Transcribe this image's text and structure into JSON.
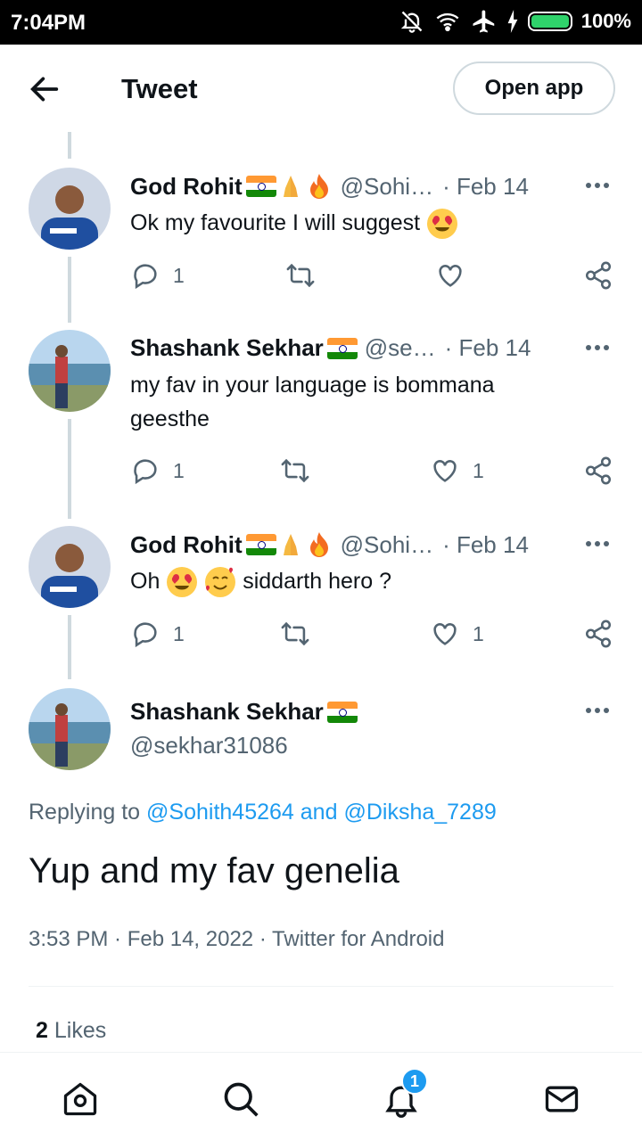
{
  "status_bar": {
    "time": "7:04PM",
    "battery": "100%"
  },
  "header": {
    "title": "Tweet",
    "open_app": "Open app"
  },
  "thread": [
    {
      "name": "God Rohit",
      "handle": "@Sohi…",
      "date": "· Feb 14",
      "text": "Ok my favourite I will suggest",
      "replies": "1",
      "retweets": "",
      "likes": ""
    },
    {
      "name": "Shashank Sekhar",
      "handle": "@se…",
      "date": "· Feb 14",
      "text": "my fav in your language is bommana geesthe",
      "replies": "1",
      "retweets": "",
      "likes": "1"
    },
    {
      "name": "God Rohit",
      "handle": "@Sohi…",
      "date": "· Feb 14",
      "text_before": "Oh",
      "text_after": "siddarth hero ?",
      "replies": "1",
      "retweets": "",
      "likes": "1"
    }
  ],
  "main_tweet": {
    "name": "Shashank Sekhar",
    "handle": "@sekhar31086",
    "replying_prefix": "Replying to",
    "replying_user1": "@Sohith45264",
    "replying_and": "and",
    "replying_user2": "@Diksha_7289",
    "text": "Yup and my fav genelia",
    "meta": "3:53 PM · Feb 14, 2022 · Twitter for Android",
    "likes_count": "2",
    "likes_label": "Likes"
  },
  "bottom_nav": {
    "notification_badge": "1"
  },
  "colors": {
    "accent": "#1d9bf0",
    "muted": "#536471",
    "line": "#cfd9de"
  }
}
